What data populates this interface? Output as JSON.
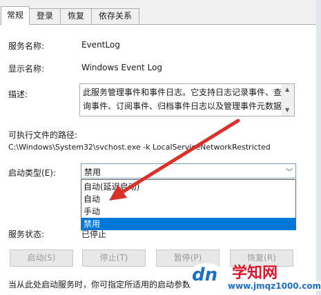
{
  "tabs": [
    "常规",
    "登录",
    "恢复",
    "依存关系"
  ],
  "general": {
    "service_name_label": "服务名称:",
    "service_name_value": "EventLog",
    "display_name_label": "显示名称:",
    "display_name_value": "Windows Event Log",
    "description_label": "描述:",
    "description_text": "此服务管理事件和事件日志。它支持日志记录事件、查询事件、订阅事件、归档事件日志以及管理事件元数据",
    "exe_path_label": "可执行文件的路径:",
    "exe_path_value": "C:\\Windows\\System32\\svchost.exe -k LocalServiceNetworkRestricted",
    "startup_type_label": "启动类型(E):",
    "startup_type_value": "禁用",
    "startup_options": [
      "自动(延迟启动)",
      "自动",
      "手动",
      "禁用"
    ],
    "selected_option": "禁用",
    "service_status_label": "服务状态:",
    "service_status_value": "已停止",
    "buttons": {
      "start": "启动(S)",
      "stop": "停止(T)",
      "pause": "暂停(P)",
      "resume": "恢复(R)"
    },
    "footer_note": "当从此处启动服务时，你可指定所适用的启动参数"
  },
  "watermark": {
    "logo_text": "dn",
    "title": "学知网",
    "url": "www.jmqz1000.com"
  },
  "colors": {
    "selection": "#0078d7",
    "arrow": "#d9302a",
    "watermark_red": "#e0142a",
    "watermark_blue": "#1d6fc4"
  },
  "icons": [
    "scroll-up-icon",
    "scroll-down-icon",
    "chevron-down-icon",
    "red-arrow-annotation"
  ]
}
